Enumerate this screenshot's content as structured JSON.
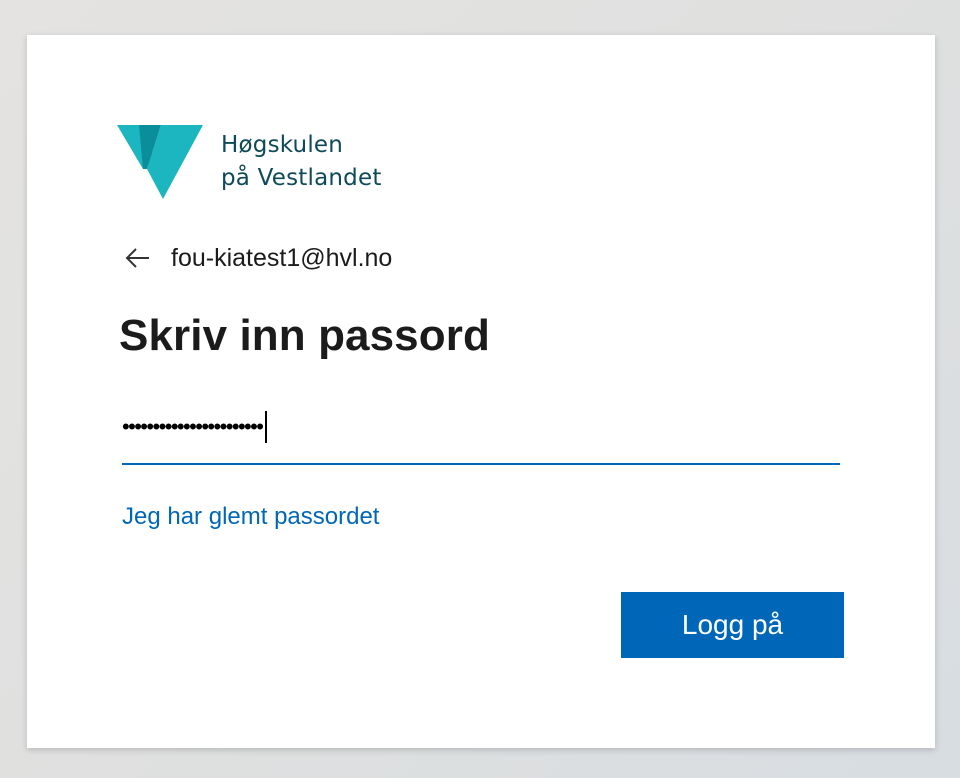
{
  "logo": {
    "line1": "Høgskulen",
    "line2": "på Vestlandet",
    "mark_color": "#1cb6c0",
    "text_color": "#0e4a57"
  },
  "identity": {
    "back_icon": "arrow-left-icon",
    "email": "fou-kiatest1@hvl.no"
  },
  "title": "Skriv inn passord",
  "password": {
    "masked_value": "•••••••••••••••••••••••"
  },
  "forgot_link": "Jeg har glemt passordet",
  "submit_label": "Logg på",
  "colors": {
    "accent": "#0067b8",
    "card": "#ffffff"
  }
}
